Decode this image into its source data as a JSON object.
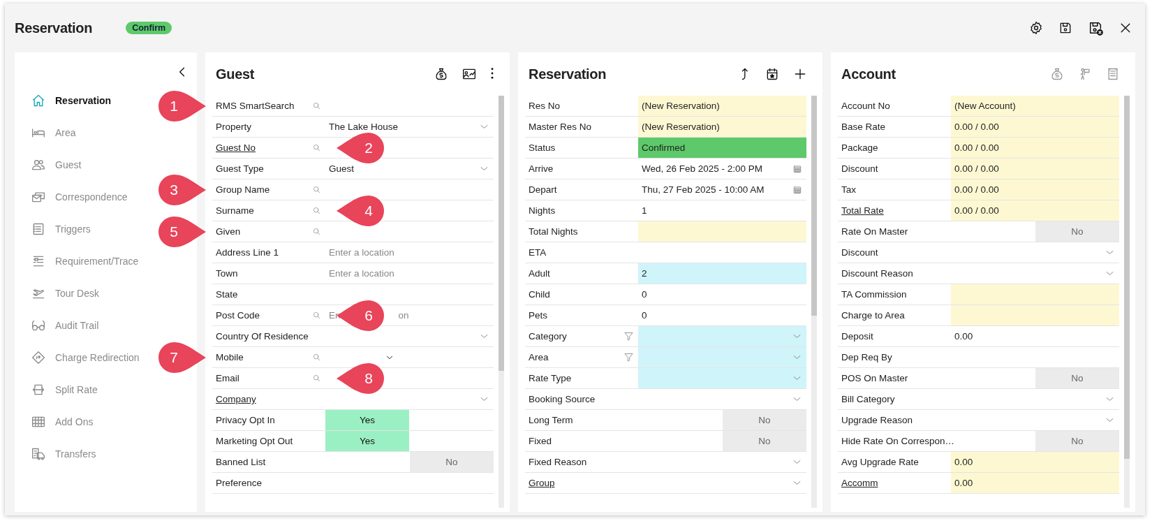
{
  "window": {
    "title": "Reservation",
    "badge": "Confirm"
  },
  "sidebar": {
    "items": [
      {
        "label": "Reservation",
        "selected": true
      },
      {
        "label": "Area",
        "selected": false
      },
      {
        "label": "Guest",
        "selected": false
      },
      {
        "label": "Correspondence",
        "selected": false
      },
      {
        "label": "Triggers",
        "selected": false
      },
      {
        "label": "Requirement/Trace",
        "selected": false
      },
      {
        "label": "Tour Desk",
        "selected": false
      },
      {
        "label": "Audit Trail",
        "selected": false
      },
      {
        "label": "Charge Redirection",
        "selected": false
      },
      {
        "label": "Split Rate",
        "selected": false
      },
      {
        "label": "Add Ons",
        "selected": false
      },
      {
        "label": "Transfers",
        "selected": false
      }
    ]
  },
  "panels": [
    {
      "title": "Guest",
      "tools": [
        {
          "disabled": false
        },
        {
          "disabled": false
        },
        {
          "disabled": false
        }
      ],
      "rows": [
        {
          "label": "RMS SmartSearch",
          "kind": "search",
          "callout": {
            "number": "1",
            "kind": "left"
          }
        },
        {
          "label": "Property",
          "kind": "select",
          "value": "The Lake House"
        },
        {
          "label": "Guest No",
          "kind": "search",
          "link": true,
          "callout": {
            "number": "2",
            "kind": "right"
          }
        },
        {
          "label": "Guest Type",
          "kind": "select",
          "value": "Guest"
        },
        {
          "label": "Group Name",
          "kind": "search",
          "callout": {
            "number": "3",
            "kind": "left"
          }
        },
        {
          "label": "Surname",
          "kind": "search",
          "callout": {
            "number": "4",
            "kind": "right"
          }
        },
        {
          "label": "Given",
          "kind": "search",
          "callout": {
            "number": "5",
            "kind": "left"
          }
        },
        {
          "label": "Address Line 1",
          "kind": "text",
          "placeholder": "Enter a location"
        },
        {
          "label": "Town",
          "kind": "text",
          "placeholder": "Enter a location"
        },
        {
          "label": "State",
          "kind": "text"
        },
        {
          "label": "Post Code",
          "kind": "search",
          "placeholder_parts": [
            "En",
            "on"
          ],
          "callout": {
            "number": "6",
            "kind": "right"
          }
        },
        {
          "label": "Country Of Residence",
          "kind": "select"
        },
        {
          "label": "Mobile",
          "kind": "phone",
          "callout": {
            "number": "7",
            "kind": "left"
          }
        },
        {
          "label": "Email",
          "kind": "search",
          "callout": {
            "number": "8",
            "kind": "right"
          }
        },
        {
          "label": "Company",
          "kind": "select",
          "link": true
        },
        {
          "label": "Privacy Opt In",
          "kind": "toggle",
          "value": "Yes",
          "on": true
        },
        {
          "label": "Marketing Opt Out",
          "kind": "toggle",
          "value": "Yes",
          "on": true
        },
        {
          "label": "Banned List",
          "kind": "toggle",
          "value": "No",
          "on": false
        },
        {
          "label": "Preference",
          "kind": "text"
        }
      ]
    },
    {
      "title": "Reservation",
      "tools": [
        {
          "disabled": false
        },
        {
          "disabled": false
        },
        {
          "disabled": false
        }
      ],
      "rows": [
        {
          "label": "Res No",
          "kind": "text",
          "value": "(New Reservation)",
          "readonly": true
        },
        {
          "label": "Master Res No",
          "kind": "text",
          "value": "(New Reservation)",
          "readonly": true
        },
        {
          "label": "Status",
          "kind": "text",
          "value": "Confirmed",
          "highlighted": true
        },
        {
          "label": "Arrive",
          "kind": "date",
          "value": "Wed, 26 Feb 2025 - 2:00 PM"
        },
        {
          "label": "Depart",
          "kind": "date",
          "value": "Thu, 27 Feb 2025 - 10:00 AM"
        },
        {
          "label": "Nights",
          "kind": "text",
          "value": "1"
        },
        {
          "label": "Total Nights",
          "kind": "text",
          "readonly": true
        },
        {
          "label": "ETA",
          "kind": "text"
        },
        {
          "label": "Adult",
          "kind": "text",
          "value": "2",
          "required": true
        },
        {
          "label": "Child",
          "kind": "text",
          "value": "0"
        },
        {
          "label": "Pets",
          "kind": "text",
          "value": "0"
        },
        {
          "label": "Category",
          "kind": "select",
          "filter": true,
          "required": true
        },
        {
          "label": "Area",
          "kind": "select",
          "filter": true,
          "required": true
        },
        {
          "label": "Rate Type",
          "kind": "select",
          "required": true
        },
        {
          "label": "Booking Source",
          "kind": "select"
        },
        {
          "label": "Long Term",
          "kind": "toggle",
          "value": "No",
          "on": false
        },
        {
          "label": "Fixed",
          "kind": "toggle",
          "value": "No",
          "on": false
        },
        {
          "label": "Fixed Reason",
          "kind": "select"
        },
        {
          "label": "Group",
          "kind": "select",
          "link": true
        }
      ]
    },
    {
      "title": "Account",
      "tools": [
        {
          "disabled": true
        },
        {
          "disabled": true
        },
        {
          "disabled": true
        }
      ],
      "rows": [
        {
          "label": "Account No",
          "kind": "text",
          "value": "(New Account)",
          "readonly": true
        },
        {
          "label": "Base Rate",
          "kind": "text",
          "value": "0.00 / 0.00",
          "readonly": true
        },
        {
          "label": "Package",
          "kind": "text",
          "value": "0.00 / 0.00",
          "readonly": true
        },
        {
          "label": "Discount",
          "kind": "text",
          "value": "0.00 / 0.00",
          "readonly": true
        },
        {
          "label": "Tax",
          "kind": "text",
          "value": "0.00 / 0.00",
          "readonly": true
        },
        {
          "label": "Total Rate",
          "kind": "text",
          "value": "0.00 / 0.00",
          "readonly": true,
          "link": true
        },
        {
          "label": "Rate On Master",
          "kind": "toggle",
          "value": "No",
          "on": false
        },
        {
          "label": "Discount",
          "kind": "select"
        },
        {
          "label": "Discount Reason",
          "kind": "select"
        },
        {
          "label": "TA Commission",
          "kind": "text",
          "readonly": true
        },
        {
          "label": "Charge to Area",
          "kind": "text",
          "readonly": true
        },
        {
          "label": "Deposit",
          "kind": "text",
          "value": "0.00"
        },
        {
          "label": "Dep Req By",
          "kind": "text"
        },
        {
          "label": "POS On Master",
          "kind": "toggle",
          "value": "No",
          "on": false
        },
        {
          "label": "Bill Category",
          "kind": "select"
        },
        {
          "label": "Upgrade Reason",
          "kind": "select"
        },
        {
          "label": "Hide Rate On Correspon…",
          "kind": "toggle",
          "value": "No",
          "on": false
        },
        {
          "label": "Avg Upgrade Rate",
          "kind": "text",
          "value": "0.00",
          "readonly": true
        },
        {
          "label": "Accomm",
          "kind": "text",
          "value": "0.00",
          "readonly": true,
          "link": true
        }
      ]
    }
  ]
}
